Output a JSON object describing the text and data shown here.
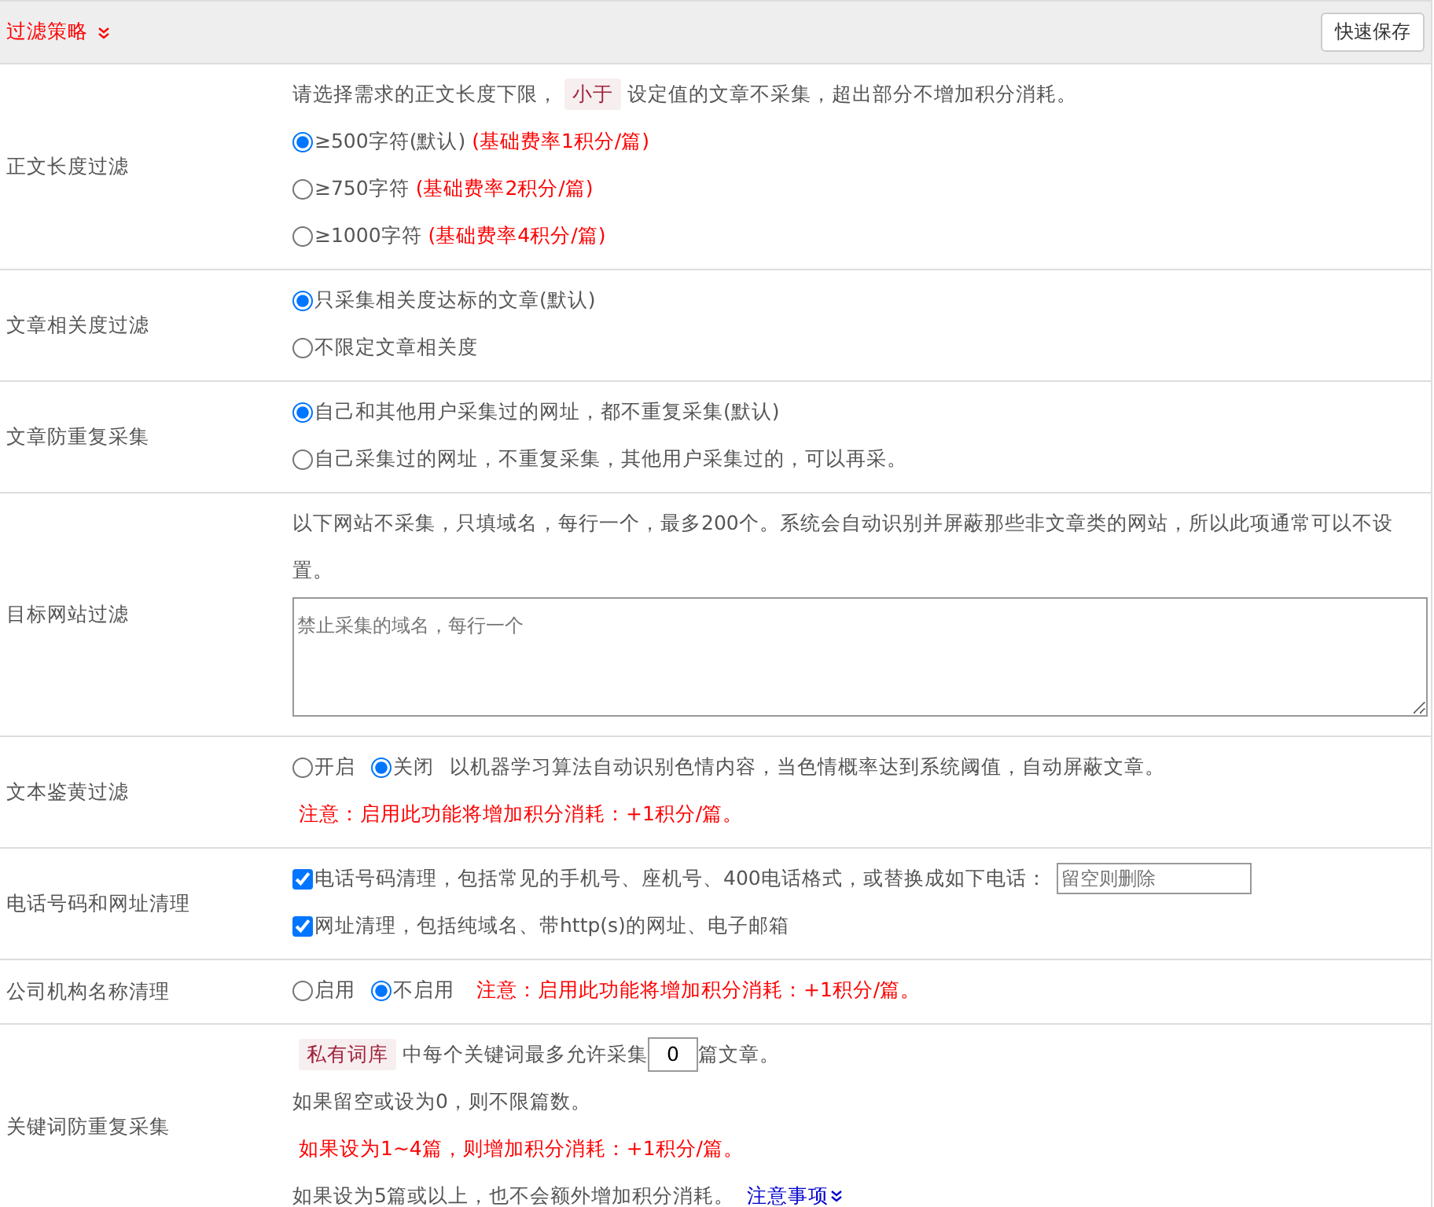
{
  "header": {
    "title": "过滤策略",
    "save_button": "快速保存"
  },
  "sections": [
    {
      "label": "正文长度过滤",
      "lines": [
        {
          "kind": "tagged",
          "before": "请选择需求的正文长度下限，",
          "tag": "小于",
          "after": "设定值的文章不采集，超出部分不增加积分消耗。"
        },
        {
          "kind": "radio",
          "label": "≥500字符(默认)",
          "selected": true,
          "note": "(基础费率1积分/篇)"
        },
        {
          "kind": "radio",
          "label": "≥750字符",
          "selected": false,
          "note": "(基础费率2积分/篇)"
        },
        {
          "kind": "radio",
          "label": "≥1000字符",
          "selected": false,
          "note": "(基础费率4积分/篇)"
        }
      ]
    },
    {
      "label": "文章相关度过滤",
      "lines": [
        {
          "kind": "radio",
          "label": "只采集相关度达标的文章(默认)",
          "selected": true
        },
        {
          "kind": "radio",
          "label": "不限定文章相关度",
          "selected": false
        }
      ]
    },
    {
      "label": "文章防重复采集",
      "lines": [
        {
          "kind": "radio",
          "label": "自己和其他用户采集过的网址，都不重复采集(默认)",
          "selected": true
        },
        {
          "kind": "radio",
          "label": "自己采集过的网址，不重复采集，其他用户采集过的，可以再采。",
          "selected": false
        }
      ]
    },
    {
      "label": "目标网站过滤",
      "lines": [
        {
          "kind": "text",
          "text": "以下网站不采集，只填域名，每行一个，最多200个。系统会自动识别并屏蔽那些非文章类的网站，所以此项通常可以不设置。"
        },
        {
          "kind": "textarea",
          "placeholder": "禁止采集的域名，每行一个"
        }
      ]
    },
    {
      "label": "文本鉴黄过滤",
      "lines": [
        {
          "kind": "radio_row",
          "options": [
            {
              "label": "开启",
              "selected": false
            },
            {
              "label": "关闭",
              "selected": true
            }
          ],
          "text": "以机器学习算法自动识别色情内容，当色情概率达到系统阈值，自动屏蔽文章。"
        },
        {
          "kind": "note",
          "text": "注意：启用此功能将增加积分消耗：+1积分/篇。"
        }
      ]
    },
    {
      "label": "电话号码和网址清理",
      "lines": [
        {
          "kind": "checkbox",
          "label": "电话号码清理，包括常见的手机号、座机号、400电话格式，或替换成如下电话：",
          "checked": true,
          "placeholder": "留空则删除"
        },
        {
          "kind": "checkbox",
          "label": "网址清理，包括纯域名、带http(s)的网址、电子邮箱",
          "checked": true
        }
      ]
    },
    {
      "label": "公司机构名称清理",
      "lines": [
        {
          "kind": "radio_row",
          "options": [
            {
              "label": "启用",
              "selected": false
            },
            {
              "label": "不启用",
              "selected": true
            }
          ],
          "note": "注意：启用此功能将增加积分消耗：+1积分/篇。"
        }
      ]
    },
    {
      "label": "关键词防重复采集",
      "lines": [
        {
          "kind": "count",
          "tag": "私有词库",
          "before": "中每个关键词最多允许采集",
          "value": "0",
          "after": "篇文章。"
        },
        {
          "kind": "text",
          "text": "如果留空或设为0，则不限篇数。"
        },
        {
          "kind": "note",
          "text": "如果设为1~4篇，则增加积分消耗：+1积分/篇。"
        },
        {
          "kind": "text_link",
          "text": "如果设为5篇或以上，也不会额外增加积分消耗。",
          "link": "注意事项"
        }
      ]
    }
  ]
}
